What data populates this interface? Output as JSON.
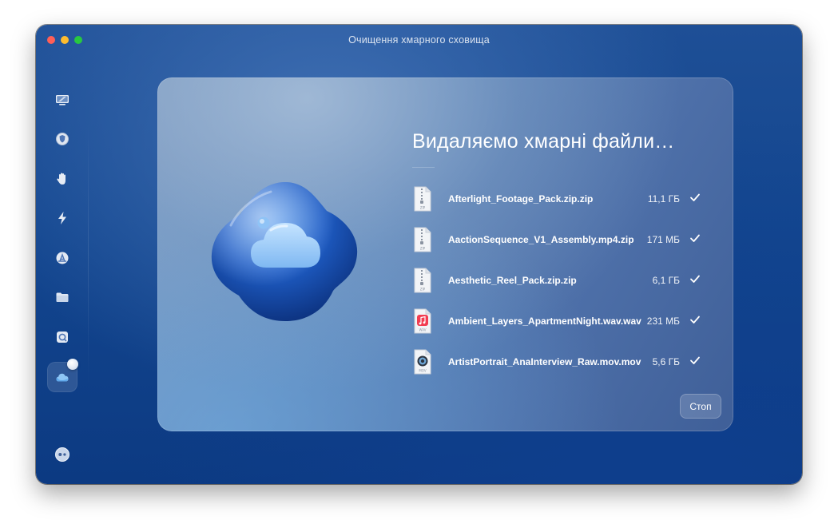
{
  "window": {
    "title": "Очищення хмарного сховища"
  },
  "sidebar": {
    "items": [
      {
        "icon": "display-icon"
      },
      {
        "icon": "protection-icon"
      },
      {
        "icon": "hand-icon"
      },
      {
        "icon": "lightning-icon"
      },
      {
        "icon": "applications-icon"
      },
      {
        "icon": "folder-icon"
      },
      {
        "icon": "disk-icon"
      },
      {
        "icon": "cloud-icon",
        "active": true
      }
    ],
    "bottom_icon": "assistant-icon"
  },
  "main": {
    "heading": "Видаляємо хмарні файли…",
    "files": [
      {
        "name": "Afterlight_Footage_Pack.zip.zip",
        "size": "11,1 ГБ",
        "type": "zip",
        "type_label": "ZIP",
        "status": "done"
      },
      {
        "name": "AactionSequence_V1_Assembly.mp4.zip",
        "size": "171 МБ",
        "type": "zip",
        "type_label": "ZIP",
        "status": "done"
      },
      {
        "name": "Aesthetic_Reel_Pack.zip.zip",
        "size": "6,1 ГБ",
        "type": "zip",
        "type_label": "ZIP",
        "status": "done"
      },
      {
        "name": "Ambient_Layers_ApartmentNight.wav.wav",
        "size": "231 МБ",
        "type": "wav",
        "type_label": "WAV",
        "status": "done"
      },
      {
        "name": "ArtistPortrait_AnaInterview_Raw.mov.mov",
        "size": "5,6 ГБ",
        "type": "mov",
        "type_label": "MOV",
        "status": "done"
      }
    ],
    "stop_label": "Стоп"
  },
  "colors": {
    "window_bg": "#13468f",
    "panel_bg": "#5b82b6",
    "accent": "#1d5fc7",
    "text": "#ffffff"
  }
}
